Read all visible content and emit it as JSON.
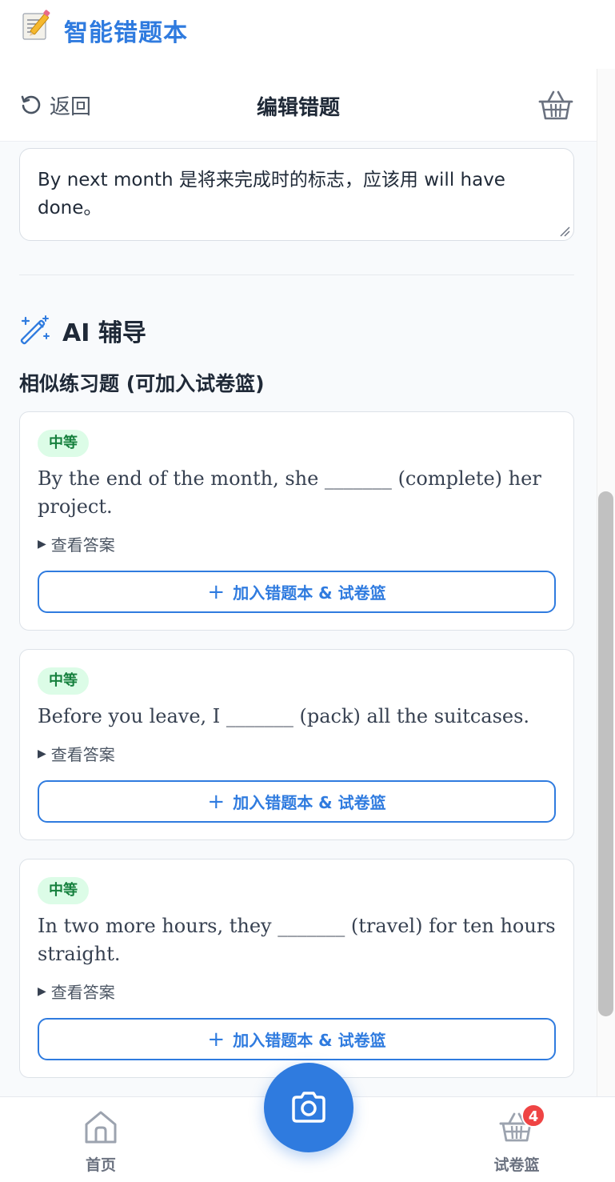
{
  "app": {
    "title": "智能错题本",
    "logo_icon": "memo-pencil-icon"
  },
  "topbar": {
    "back_label": "返回",
    "title": "编辑错题"
  },
  "explanation": {
    "text": "By next month 是将来完成时的标志，应该用 will have done。"
  },
  "ai_section": {
    "heading": "AI 辅导",
    "subtitle": "相似练习题 (可加入试卷篮)"
  },
  "practice": [
    {
      "difficulty": "中等",
      "question": "By the end of the month, she _______ (complete) her project.",
      "answer_toggle": "查看答案",
      "add_label": "加入错题本 & 试卷篮"
    },
    {
      "difficulty": "中等",
      "question": "Before you leave, I _______ (pack) all the suitcases.",
      "answer_toggle": "查看答案",
      "add_label": "加入错题本 & 试卷篮"
    },
    {
      "difficulty": "中等",
      "question": "In two more hours, they _______ (travel) for ten hours straight.",
      "answer_toggle": "查看答案",
      "add_label": "加入错题本 & 试卷篮"
    }
  ],
  "bottom_nav": {
    "home_label": "首页",
    "basket_label": "试卷篮",
    "basket_count": "4"
  },
  "colors": {
    "accent": "#2f7bdf",
    "badge_bg": "#dcfce7",
    "badge_text": "#15803d",
    "notify": "#ef4444"
  }
}
